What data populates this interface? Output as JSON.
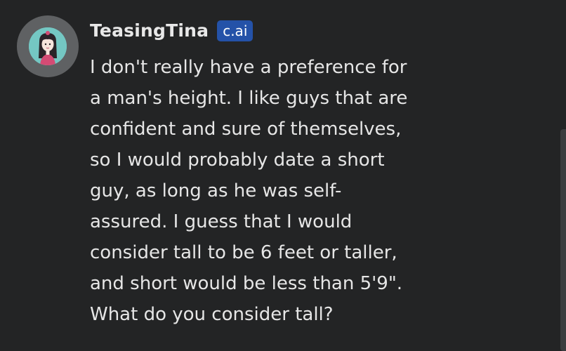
{
  "message": {
    "author": "TeasingTina",
    "badge": "c.ai",
    "lines": [
      "I don't really have a preference for",
      "a man's height. I like guys that are",
      "confident and sure of themselves,",
      "so I would probably date a short",
      "guy, as long as he was self-",
      "assured. I guess that I would",
      "consider tall to be 6 feet or taller,",
      "and short would be less than 5'9\".",
      "What do you consider tall?"
    ],
    "avatar_icon": "character-avatar-icon"
  },
  "colors": {
    "background": "#232425",
    "text": "#e6e6e6",
    "badge": "#2452a8",
    "avatar_ring": "#5f6163",
    "avatar_bg": "#74c7c3"
  }
}
